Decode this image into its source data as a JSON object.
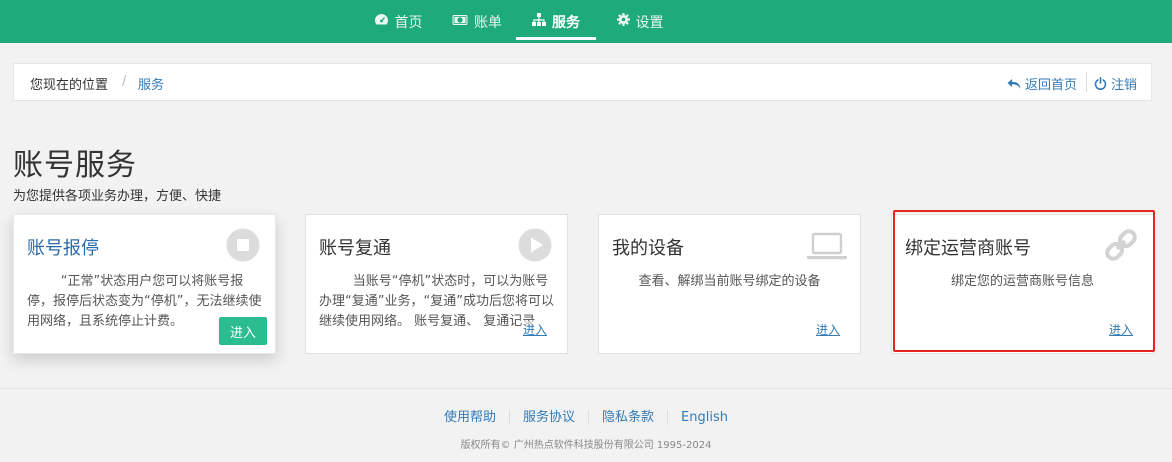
{
  "nav": {
    "items": [
      {
        "label": "首页",
        "icon": "dashboard-icon"
      },
      {
        "label": "账单",
        "icon": "bill-icon"
      },
      {
        "label": "服务",
        "icon": "sitemap-icon",
        "active": true
      },
      {
        "label": "设置",
        "icon": "gear-icon"
      }
    ]
  },
  "breadcrumb": {
    "here_label": "您现在的位置",
    "separator": "/",
    "current": "服务",
    "back_label": "返回首页",
    "logout_label": "注销"
  },
  "page": {
    "title": "账号服务",
    "subtitle": "为您提供各项业务办理，方便、快捷"
  },
  "cards": [
    {
      "title": "账号报停",
      "icon": "stop-icon",
      "desc": "“正常”状态用户您可以将账号报停，报停后状态变为“停机”，无法继续使用网络，且系统停止计费。",
      "action": "进入"
    },
    {
      "title": "账号复通",
      "icon": "play-icon",
      "desc": "当账号“停机”状态时，可以为账号办理“复通”业务，“复通”成功后您将可以继续使用网络。 账号复通、 复通记录",
      "action": "进入"
    },
    {
      "title": "我的设备",
      "icon": "laptop-icon",
      "desc": "查看、解绑当前账号绑定的设备",
      "action": "进入"
    },
    {
      "title": "绑定运营商账号",
      "icon": "link-icon",
      "desc": "绑定您的运营商账号信息",
      "action": "进入"
    }
  ],
  "footer": {
    "links": [
      "使用帮助",
      "服务协议",
      "隐私条款",
      "English"
    ],
    "copyright": "版权所有© 广州热点软件科技股份有限公司 1995-2024"
  },
  "colors": {
    "nav_bg": "#1faa7c",
    "link": "#337ab7",
    "enter_button": "#2bbd8f",
    "highlight": "#e8241f"
  }
}
